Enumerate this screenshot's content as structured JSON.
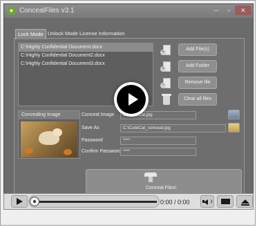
{
  "app": {
    "title": "ConcealFiles v3.1",
    "window_buttons": {
      "minimize": "─",
      "maximize": "▫",
      "close": "✕"
    }
  },
  "tabs": [
    {
      "label": "Lock Mode",
      "active": true
    },
    {
      "label": "Unlock Mode",
      "active": false
    },
    {
      "label": "License Information",
      "active": false
    }
  ],
  "files": [
    {
      "path": "C:\\Highly Confidential Document.docx",
      "selected": true
    },
    {
      "path": "C:\\Highly Confidential Document2.docx",
      "selected": false
    },
    {
      "path": "C:\\Highly Confidential Document3.docx",
      "selected": false
    }
  ],
  "actions": {
    "add_files": "Add File(s)",
    "add_folder": "Add Folder",
    "remove_file": "Remove file",
    "clear_all": "Clear all files"
  },
  "concealing_image": {
    "title": "Concealing Image"
  },
  "form": {
    "conceal_image_label": "Conceal Image",
    "conceal_image_value": "C:\\CuteCat.jpg",
    "save_as_label": "Save As",
    "save_as_value": "C:\\CuteCat_conceal.jpg",
    "password_label": "Password",
    "password_value": "****",
    "confirm_password_label": "Confirm Password",
    "confirm_password_value": "****"
  },
  "conceal_button": {
    "label": "Conceal Files!"
  },
  "player": {
    "time": "0:00 / 0:00",
    "progress": 0
  },
  "colors": {
    "dimmed_window": "#6b6b6b",
    "play_button": "#000000",
    "close_button": "#9b5c5c"
  }
}
